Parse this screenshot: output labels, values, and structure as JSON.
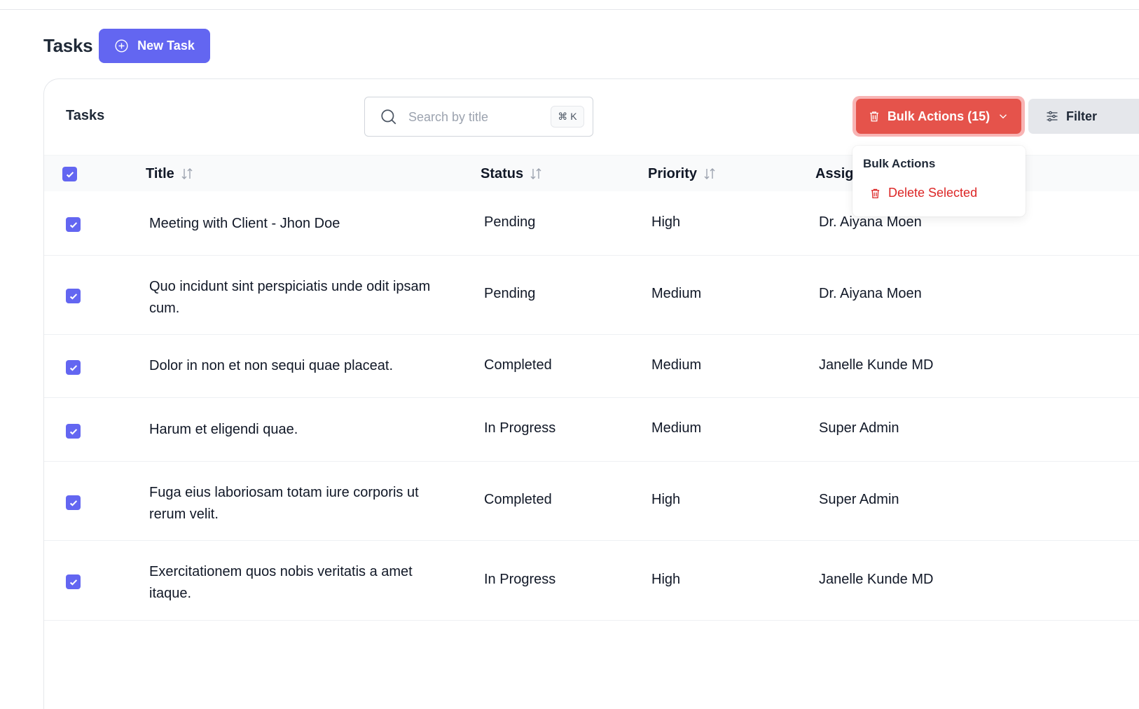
{
  "page": {
    "title": "Tasks",
    "new_task_label": "New Task"
  },
  "card": {
    "title": "Tasks",
    "search": {
      "placeholder": "Search by title",
      "value": "",
      "shortcut": "⌘ K"
    },
    "bulk_actions_label": "Bulk Actions (15)",
    "filter_label": "Filter"
  },
  "table": {
    "columns": [
      "Title",
      "Status",
      "Priority",
      "Assign"
    ],
    "rows": [
      {
        "title": "Meeting with Client - Jhon Doe",
        "status": "Pending",
        "priority": "High",
        "assignee": "Dr. Aiyana Moen",
        "checked": true
      },
      {
        "title": "Quo incidunt sint perspiciatis unde odit ipsam cum.",
        "status": "Pending",
        "priority": "Medium",
        "assignee": "Dr. Aiyana Moen",
        "checked": true
      },
      {
        "title": "Dolor in non et non sequi quae placeat.",
        "status": "Completed",
        "priority": "Medium",
        "assignee": "Janelle Kunde MD",
        "checked": true
      },
      {
        "title": "Harum et eligendi quae.",
        "status": "In Progress",
        "priority": "Medium",
        "assignee": "Super Admin",
        "checked": true
      },
      {
        "title": "Fuga eius laboriosam totam iure corporis ut rerum velit.",
        "status": "Completed",
        "priority": "High",
        "assignee": "Super Admin",
        "checked": true
      },
      {
        "title": "Exercitationem quos nobis veritatis a amet itaque.",
        "status": "In Progress",
        "priority": "High",
        "assignee": "Janelle Kunde MD",
        "checked": true
      }
    ]
  },
  "dropdown": {
    "header": "Bulk Actions",
    "items": [
      {
        "label": "Delete Selected"
      }
    ]
  },
  "colors": {
    "accent": "#6366f1",
    "danger": "#e5534b",
    "danger_text": "#dc2626"
  }
}
